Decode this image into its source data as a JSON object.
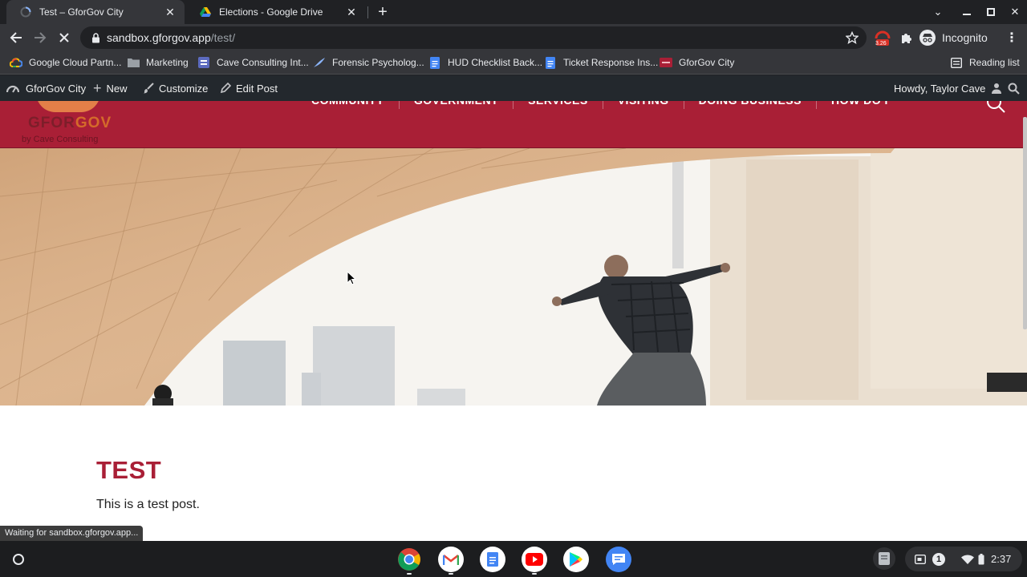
{
  "browser": {
    "tabs": [
      {
        "title": "Test – GforGov City",
        "active": true
      },
      {
        "title": "Elections - Google Drive",
        "active": false
      }
    ],
    "address": {
      "host": "sandbox.gforgov.app",
      "path": "/test/"
    },
    "profile_label": "Incognito",
    "ext_badge": "3.26",
    "bookmarks": [
      {
        "label": "Google Cloud Partn...",
        "icon": "google-cloud-icon"
      },
      {
        "label": "Marketing",
        "icon": "folder-icon"
      },
      {
        "label": "Cave Consulting Int...",
        "icon": "forms-icon"
      },
      {
        "label": "Forensic Psycholog...",
        "icon": "quill-icon"
      },
      {
        "label": "HUD Checklist Back...",
        "icon": "docs-icon"
      },
      {
        "label": "Ticket Response Ins...",
        "icon": "docs-icon"
      },
      {
        "label": "GforGov City",
        "icon": "gforgov-icon"
      }
    ],
    "reading_list": "Reading list",
    "status": "Waiting for sandbox.gforgov.app..."
  },
  "admin_bar": {
    "site": "GforGov City",
    "new": "New",
    "customize": "Customize",
    "edit": "Edit Post",
    "howdy": "Howdy, Taylor Cave"
  },
  "site": {
    "logo_word_a": "GFOR",
    "logo_word_b": "GOV",
    "logo_sub": "by Cave Consulting",
    "nav": [
      "COMMUNITY",
      "GOVERNMENT",
      "SERVICES",
      "VISITING",
      "DOING BUSINESS",
      "HOW DO I"
    ],
    "accent": "#a91f36"
  },
  "post": {
    "title": "TEST",
    "body": "This is a test post."
  },
  "shelf": {
    "apps": [
      "chrome-icon",
      "gmail-icon",
      "docs-icon",
      "youtube-icon",
      "play-store-icon",
      "messages-icon"
    ],
    "notification_count": "1",
    "time": "2:37"
  }
}
